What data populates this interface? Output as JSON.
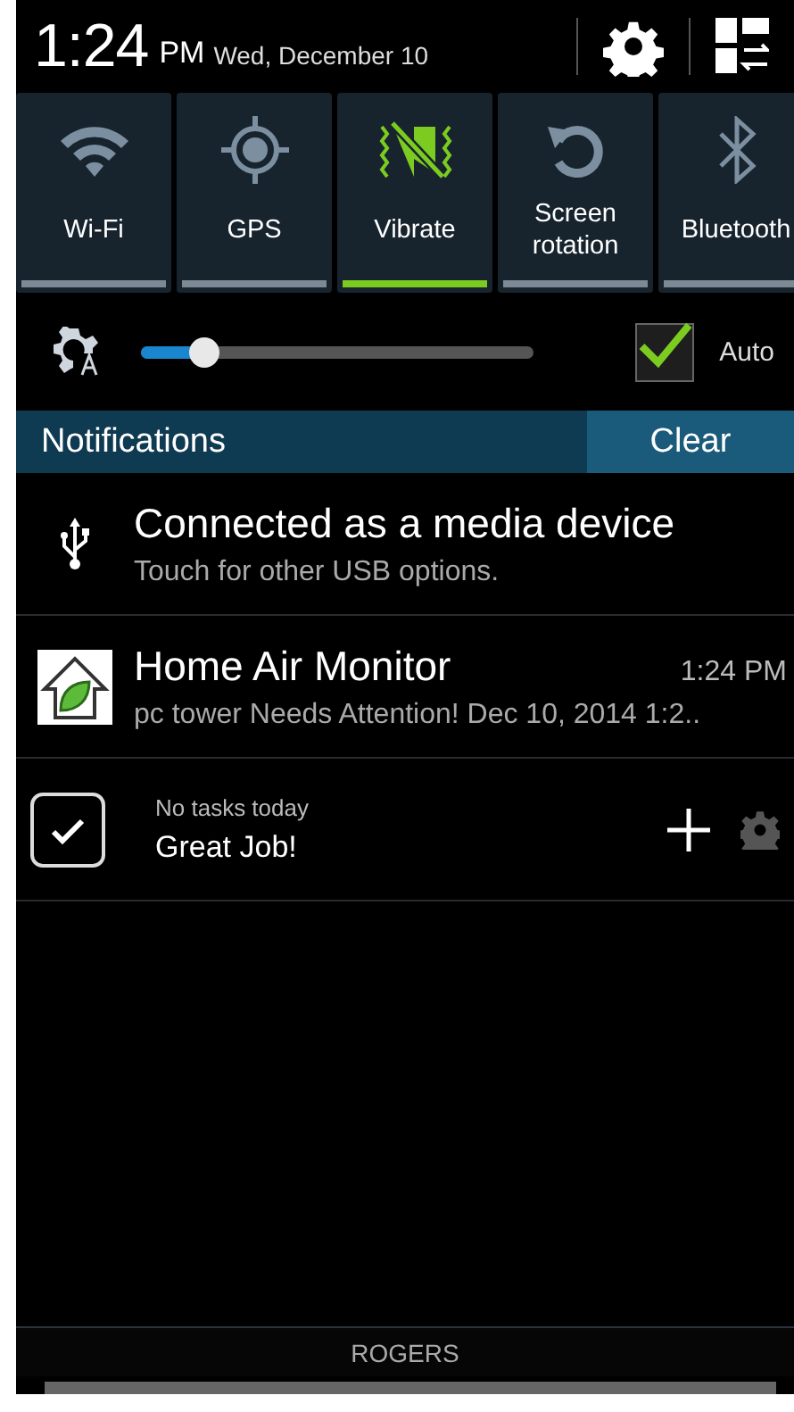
{
  "status_header": {
    "time": "1:24",
    "ampm": "PM",
    "date": "Wed, December 10"
  },
  "quick_toggles": [
    {
      "kind": "wifi",
      "label": "Wi-Fi",
      "on": false
    },
    {
      "kind": "gps",
      "label": "GPS",
      "on": false
    },
    {
      "kind": "vibrate",
      "label": "Vibrate",
      "on": true
    },
    {
      "kind": "rotation",
      "label": "Screen rotation",
      "on": false
    },
    {
      "kind": "bluetooth",
      "label": "Bluetooth",
      "on": false
    }
  ],
  "brightness": {
    "level": 0.16,
    "auto": {
      "label": "Auto",
      "checked": true
    }
  },
  "notifications_bar": {
    "title": "Notifications",
    "clear": "Clear"
  },
  "notifications": [
    {
      "kind": "usb",
      "title": "Connected as a media device",
      "text": "Touch for other USB options."
    },
    {
      "kind": "app",
      "title": "Home Air Monitor",
      "time": "1:24 PM",
      "text": "pc tower Needs Attention! Dec 10, 2014 1:2.."
    },
    {
      "kind": "tasks",
      "caption": "No tasks today",
      "title": "Great Job!"
    }
  ],
  "carrier": "ROGERS"
}
